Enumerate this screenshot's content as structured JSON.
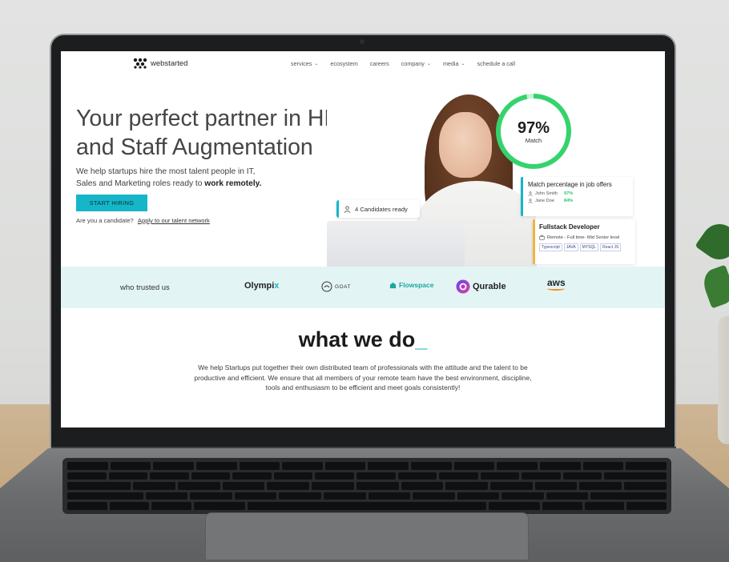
{
  "nav": {
    "logo_text": "webstarted",
    "links": [
      {
        "label": "services",
        "has_dropdown": true
      },
      {
        "label": "ecosystem",
        "has_dropdown": false
      },
      {
        "label": "careers",
        "has_dropdown": false
      },
      {
        "label": "company",
        "has_dropdown": true
      },
      {
        "label": "media",
        "has_dropdown": true
      },
      {
        "label": "schedule a call",
        "has_dropdown": false
      }
    ]
  },
  "hero": {
    "title_line1": "Your perfect partner in HR",
    "title_line2": "and Staff Augmentation",
    "sub_line1": "We help startups hire the most talent people in IT,",
    "sub_line2_start": "Sales and Marketing roles ready to ",
    "sub_line2_bold": "work remotely.",
    "cta_label": "START HIRING",
    "candidate_prompt": "Are you a candidate?",
    "candidate_link": "Apply to our talent network"
  },
  "match": {
    "percent_label": "97%",
    "percent_value": 97,
    "label": "Match"
  },
  "candidates_card": {
    "text": "4 Candidates ready"
  },
  "offers_card": {
    "title": "Match percentage in job offers",
    "rows": [
      {
        "name": "John Smith",
        "pct": "97%"
      },
      {
        "name": "Jane Doe",
        "pct": "84%"
      }
    ]
  },
  "job_card": {
    "title": "Fullstack Developer",
    "subtitle": "Remote - Full time- Mid Senior level",
    "tags": [
      "Typescript",
      "JAVA",
      "MYSQL",
      "React JS"
    ]
  },
  "trusted": {
    "label": "who trusted us",
    "brands": {
      "olympix_main": "Olympi",
      "olympix_x": "x",
      "goat": "GOAT",
      "flowspace": "Flowspace",
      "qurable": "Qurable",
      "aws": "aws"
    }
  },
  "what_we_do": {
    "title": "what we do",
    "cursor": "_",
    "body": "We help Startups put together their own distributed team of professionals with the attitude and the talent to be productive and efficient. We ensure that all members of your remote team have the best environment, discipline, tools and enthusiasm to be efficient and meet goals consistently!"
  },
  "colors": {
    "accent": "#16b6c9",
    "match_green": "#35d36e",
    "trusted_bg": "#e3f4f5",
    "job_card_accent": "#f2b33d"
  }
}
